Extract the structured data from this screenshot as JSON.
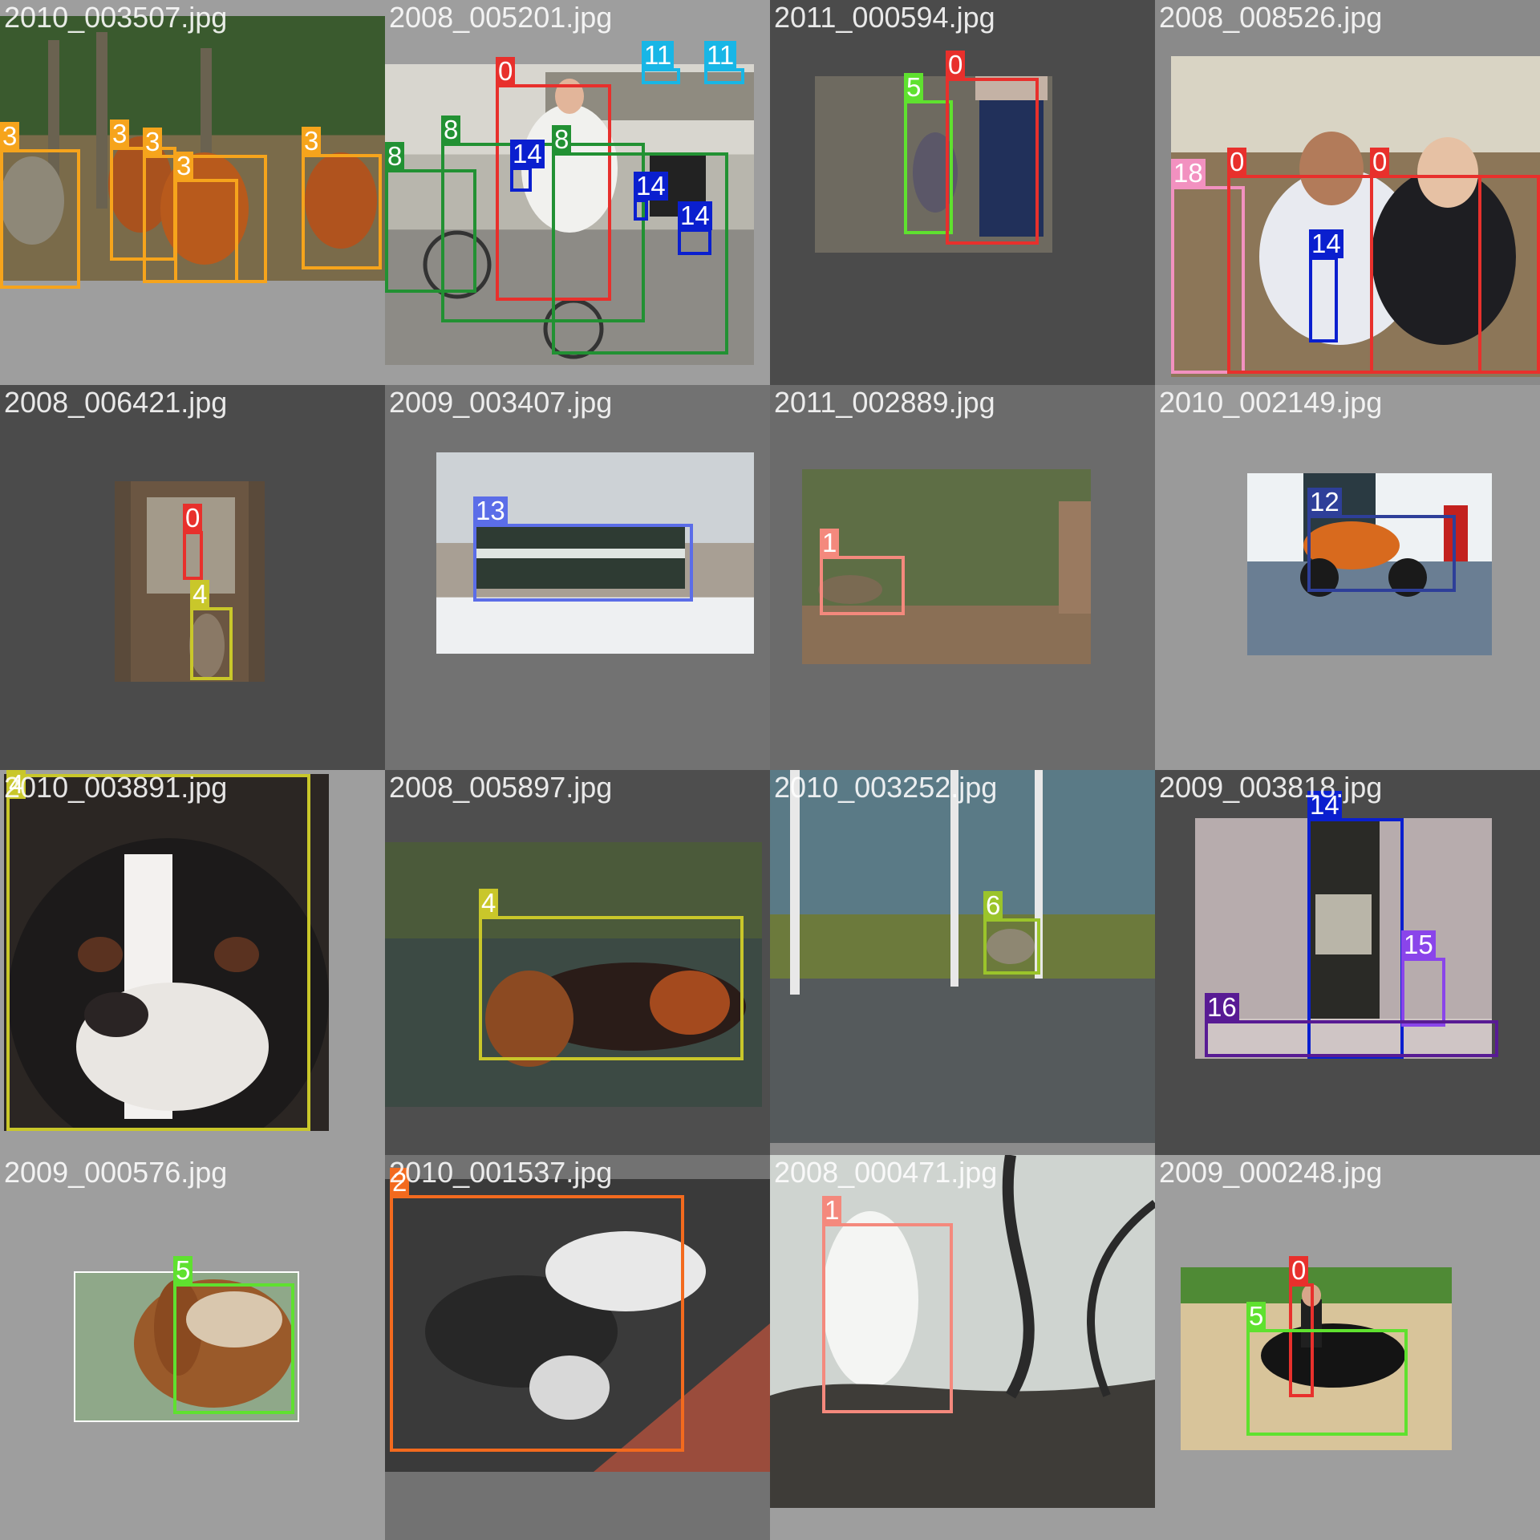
{
  "class_colors": {
    "0": "#e8302c",
    "1": "#f4897d",
    "2": "#f36a1e",
    "3": "#f6a41c",
    "4": "#c9c72a",
    "5": "#5fe12f",
    "6": "#9bc42b",
    "8": "#229133",
    "11": "#18b6e6",
    "12": "#2e3f99",
    "13": "#5b6de8",
    "14": "#0a1fcf",
    "15": "#8a45ea",
    "16": "#581b94",
    "18": "#f291c0"
  },
  "tiles": [
    {
      "filename": "2010_003507.jpg",
      "bg": "#9e9e9e",
      "photo_bg": "#6d6a43",
      "boxes": [
        {
          "label": "3",
          "cls": "3"
        },
        {
          "label": "3",
          "cls": "3"
        },
        {
          "label": "3",
          "cls": "3"
        },
        {
          "label": "3",
          "cls": "3"
        },
        {
          "label": "3",
          "cls": "3"
        }
      ]
    },
    {
      "filename": "2008_005201.jpg",
      "bg": "#9e9e9e",
      "photo_bg": "#b8b6ad",
      "boxes": [
        {
          "label": "0",
          "cls": "0"
        },
        {
          "label": "11",
          "cls": "11"
        },
        {
          "label": "11",
          "cls": "11"
        },
        {
          "label": "8",
          "cls": "8"
        },
        {
          "label": "8",
          "cls": "8"
        },
        {
          "label": "8",
          "cls": "8"
        },
        {
          "label": "14",
          "cls": "14"
        },
        {
          "label": "14",
          "cls": "14"
        },
        {
          "label": "14",
          "cls": "14"
        }
      ]
    },
    {
      "filename": "2011_000594.jpg",
      "bg": "#4b4b4b",
      "photo_bg": "#6e6a60",
      "boxes": [
        {
          "label": "5",
          "cls": "5"
        },
        {
          "label": "0",
          "cls": "0"
        }
      ]
    },
    {
      "filename": "2008_008526.jpg",
      "bg": "#8a8a8a",
      "photo_bg": "#a08c6e",
      "boxes": [
        {
          "label": "18",
          "cls": "18"
        },
        {
          "label": "0",
          "cls": "0"
        },
        {
          "label": "0",
          "cls": "0"
        },
        {
          "label": "14",
          "cls": "14"
        }
      ]
    },
    {
      "filename": "2008_006421.jpg",
      "bg": "#4b4b4b",
      "photo_bg": "#5a4a3a",
      "boxes": [
        {
          "label": "0",
          "cls": "0"
        },
        {
          "label": "4",
          "cls": "4"
        }
      ]
    },
    {
      "filename": "2009_003407.jpg",
      "bg": "#727272",
      "photo_bg": "#a89f94",
      "boxes": [
        {
          "label": "13",
          "cls": "13"
        }
      ]
    },
    {
      "filename": "2011_002889.jpg",
      "bg": "#6b6b6b",
      "photo_bg": "#4c5a3c",
      "boxes": [
        {
          "label": "1",
          "cls": "1"
        }
      ]
    },
    {
      "filename": "2010_002149.jpg",
      "bg": "#9a9a9a",
      "photo_bg": "#7a8d9c",
      "boxes": [
        {
          "label": "12",
          "cls": "12"
        }
      ]
    },
    {
      "filename": "2010_003891.jpg",
      "bg": "#9e9e9e",
      "photo_bg": "#2b2623",
      "boxes": [
        {
          "label": "4",
          "cls": "4"
        }
      ]
    },
    {
      "filename": "2008_005897.jpg",
      "bg": "#4e4e4e",
      "photo_bg": "#3e4a3e",
      "boxes": [
        {
          "label": "4",
          "cls": "4"
        }
      ]
    },
    {
      "filename": "2010_003252.jpg",
      "bg": "#8c8c8c",
      "photo_bg": "#6b6e70",
      "boxes": [
        {
          "label": "6",
          "cls": "6"
        }
      ]
    },
    {
      "filename": "2009_003818.jpg",
      "bg": "#4b4b4b",
      "photo_bg": "#a59c9c",
      "boxes": [
        {
          "label": "14",
          "cls": "14"
        },
        {
          "label": "15",
          "cls": "15"
        },
        {
          "label": "16",
          "cls": "16"
        }
      ]
    },
    {
      "filename": "2009_000576.jpg",
      "bg": "#9e9e9e",
      "photo_bg": "#8e9a86",
      "boxes": [
        {
          "label": "5",
          "cls": "5"
        }
      ]
    },
    {
      "filename": "2010_001537.jpg",
      "bg": "#727272",
      "photo_bg": "#3a3a3a",
      "boxes": [
        {
          "label": "2",
          "cls": "2"
        }
      ]
    },
    {
      "filename": "2008_000471.jpg",
      "bg": "#9e9e9e",
      "photo_bg": "#8a8d87",
      "boxes": [
        {
          "label": "1",
          "cls": "1"
        }
      ]
    },
    {
      "filename": "2009_000248.jpg",
      "bg": "#9e9e9e",
      "photo_bg": "#c6b58d",
      "boxes": [
        {
          "label": "0",
          "cls": "0"
        },
        {
          "label": "5",
          "cls": "5"
        }
      ]
    }
  ]
}
